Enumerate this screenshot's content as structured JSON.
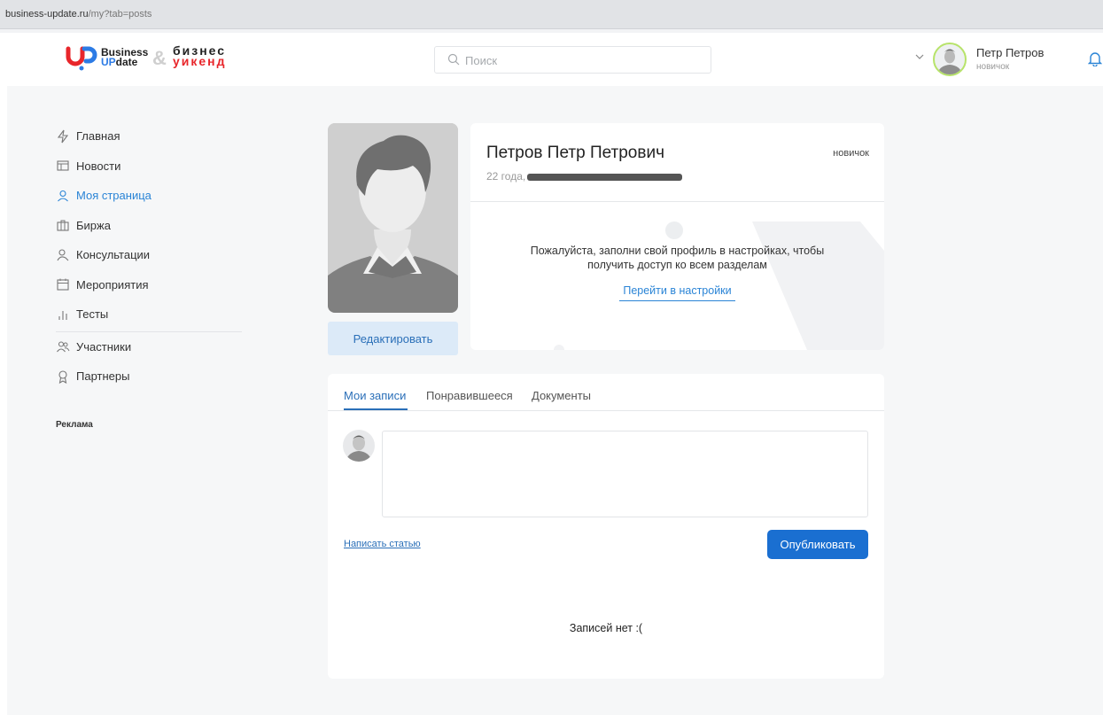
{
  "browser": {
    "url_host": "business-update.ru",
    "url_path": "/my?tab=posts"
  },
  "header": {
    "logo": {
      "line1": "Business",
      "line2_prefix": "UP",
      "line2_suffix": "date",
      "amp": "&",
      "second_line1": "бизнес",
      "second_line2": "уикенд"
    },
    "search": {
      "placeholder": "Поиск"
    },
    "user": {
      "name": "Петр Петров",
      "role": "новичок"
    }
  },
  "sidebar": {
    "items": [
      {
        "label": "Главная",
        "icon": "lightning-icon"
      },
      {
        "label": "Новости",
        "icon": "news-icon"
      },
      {
        "label": "Моя страница",
        "icon": "user-icon",
        "active": true
      },
      {
        "label": "Биржа",
        "icon": "briefcase-icon"
      },
      {
        "label": "Консультации",
        "icon": "consult-icon"
      },
      {
        "label": "Мероприятия",
        "icon": "calendar-icon"
      },
      {
        "label": "Тесты",
        "icon": "bars-icon"
      },
      {
        "label": "Участники",
        "icon": "users-icon"
      },
      {
        "label": "Партнеры",
        "icon": "award-icon"
      }
    ],
    "ad_label": "Реклама"
  },
  "profile": {
    "edit_label": "Редактировать",
    "full_name": "Петров Петр Петрович",
    "age": "22 года,",
    "role": "новичок",
    "notice": "Пожалуйста, заполни свой профиль в настройках, чтобы получить доступ ко всем разделам",
    "settings_link": "Перейти в настройки"
  },
  "posts": {
    "tabs": [
      "Мои записи",
      "Понравившееся",
      "Документы"
    ],
    "active_tab": 0,
    "write_article": "Написать статью",
    "publish": "Опубликовать",
    "empty": "Записей нет :("
  },
  "colors": {
    "accent": "#2a84d6",
    "primary_button": "#1a6fd1",
    "brand_red": "#e8262b"
  }
}
